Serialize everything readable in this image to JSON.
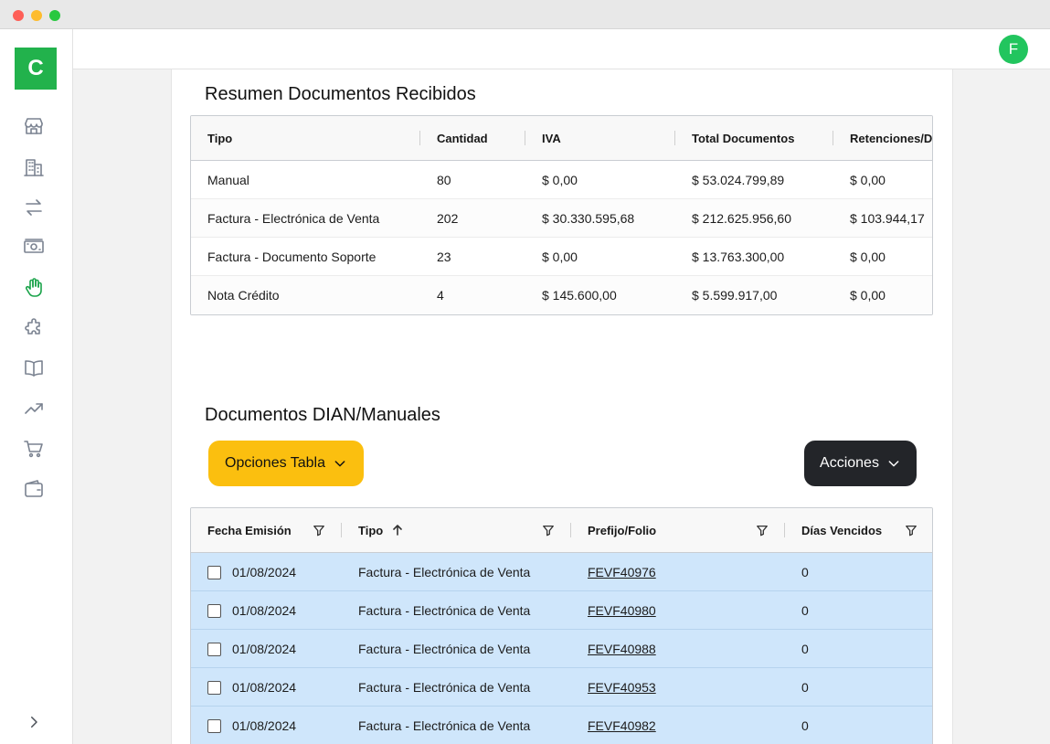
{
  "app": {
    "logo_letter": "C",
    "user_initial": "F",
    "accent_color": "#22b24c"
  },
  "sidebar": {
    "items": [
      {
        "icon": "store-icon"
      },
      {
        "icon": "building-icon"
      },
      {
        "icon": "transfer-arrows-icon"
      },
      {
        "icon": "cash-icon"
      },
      {
        "icon": "hand-icon",
        "active": true
      },
      {
        "icon": "puzzle-icon"
      },
      {
        "icon": "book-icon"
      },
      {
        "icon": "trend-up-icon"
      },
      {
        "icon": "cart-icon"
      },
      {
        "icon": "wallet-icon"
      }
    ],
    "expand_icon": "chevron-right-icon"
  },
  "summary": {
    "title": "Resumen Documentos Recibidos",
    "columns": [
      "Tipo",
      "Cantidad",
      "IVA",
      "Total Documentos",
      "Retenciones/D"
    ],
    "rows": [
      [
        "Manual",
        "80",
        "$ 0,00",
        "$ 53.024.799,89",
        "$ 0,00"
      ],
      [
        "Factura - Electrónica de Venta",
        "202",
        "$ 30.330.595,68",
        "$ 212.625.956,60",
        "$ 103.944,17"
      ],
      [
        "Factura - Documento Soporte",
        "23",
        "$ 0,00",
        "$ 13.763.300,00",
        "$ 0,00"
      ],
      [
        "Nota Crédito",
        "4",
        "$ 145.600,00",
        "$ 5.599.917,00",
        "$ 0,00"
      ]
    ]
  },
  "documents": {
    "title": "Documentos DIAN/Manuales",
    "options_label": "Opciones Tabla",
    "actions_label": "Acciones",
    "columns": [
      "Fecha Emisión",
      "Tipo",
      "Prefijo/Folio",
      "Días Vencidos"
    ],
    "rows": [
      [
        "01/08/2024",
        "Factura - Electrónica de Venta",
        "FEVF40976",
        "0"
      ],
      [
        "01/08/2024",
        "Factura - Electrónica de Venta",
        "FEVF40980",
        "0"
      ],
      [
        "01/08/2024",
        "Factura - Electrónica de Venta",
        "FEVF40988",
        "0"
      ],
      [
        "01/08/2024",
        "Factura - Electrónica de Venta",
        "FEVF40953",
        "0"
      ],
      [
        "01/08/2024",
        "Factura - Electrónica de Venta",
        "FEVF40982",
        "0"
      ]
    ]
  }
}
